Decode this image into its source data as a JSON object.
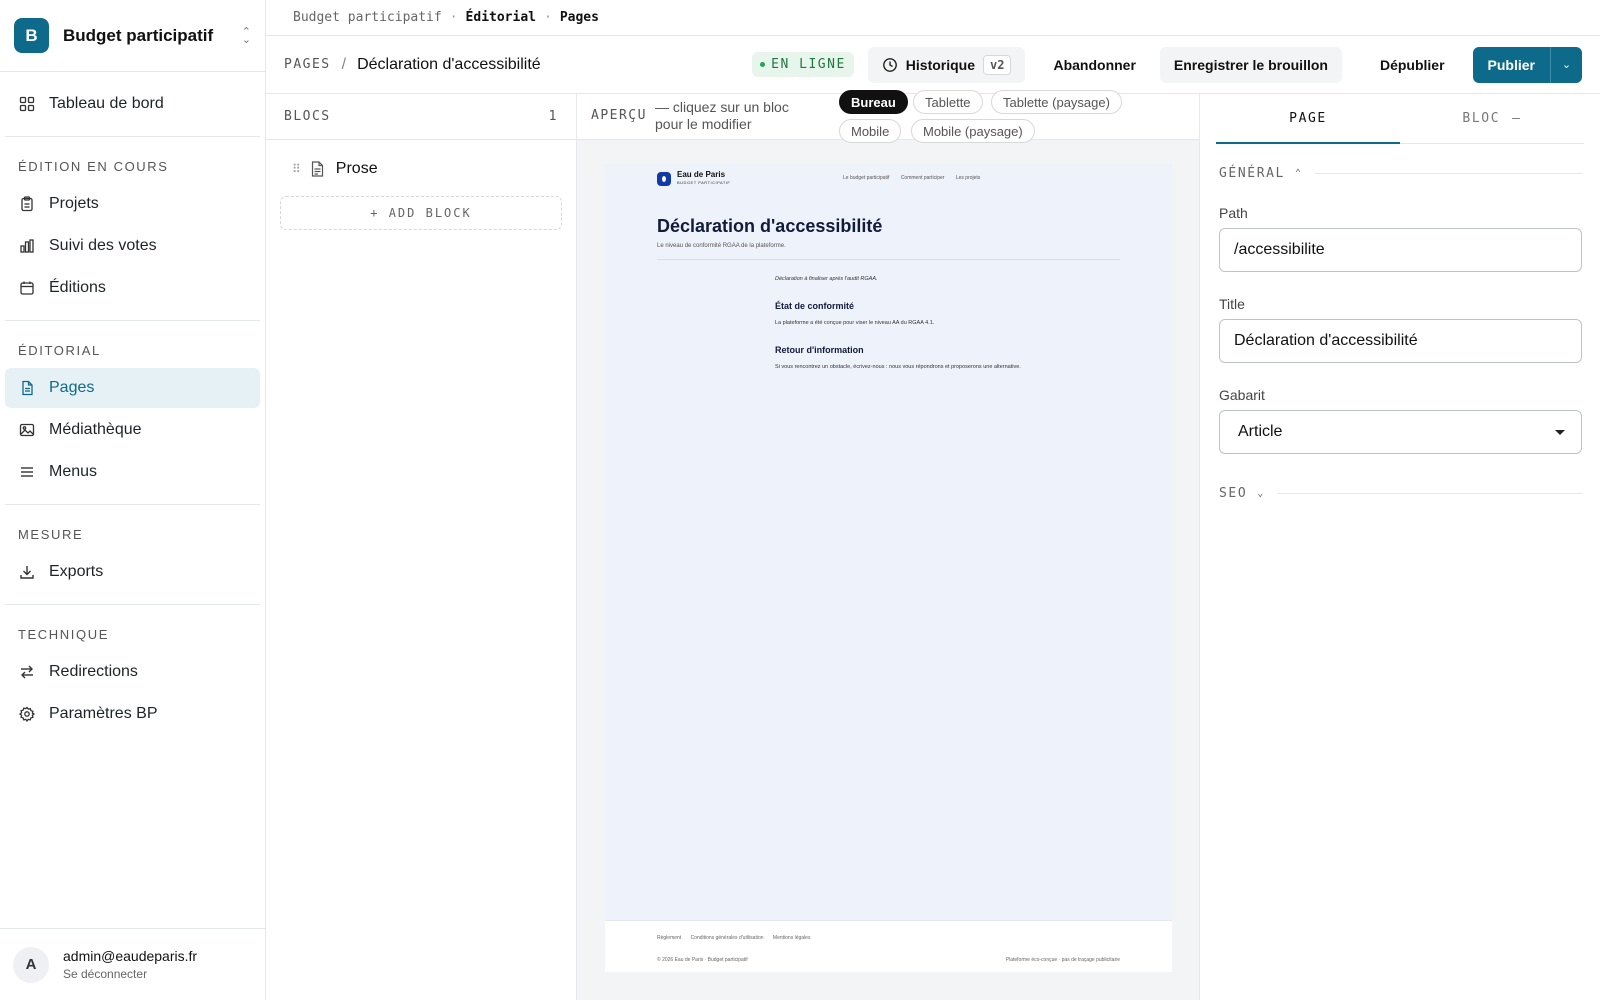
{
  "sidebar": {
    "workspace": {
      "initial": "B",
      "name": "Budget participatif"
    },
    "dashboard": {
      "label": "Tableau de bord",
      "icon": "grid-icon"
    },
    "groups": [
      {
        "title": "ÉDITION EN COURS",
        "items": [
          {
            "label": "Projets",
            "icon": "clipboard-icon"
          },
          {
            "label": "Suivi des votes",
            "icon": "bar-chart-icon"
          },
          {
            "label": "Éditions",
            "icon": "calendar-icon"
          }
        ]
      },
      {
        "title": "ÉDITORIAL",
        "items": [
          {
            "label": "Pages",
            "icon": "file-icon",
            "active": true
          },
          {
            "label": "Médiathèque",
            "icon": "image-icon"
          },
          {
            "label": "Menus",
            "icon": "menu-icon"
          }
        ]
      },
      {
        "title": "MESURE",
        "items": [
          {
            "label": "Exports",
            "icon": "download-icon"
          }
        ]
      },
      {
        "title": "TECHNIQUE",
        "items": [
          {
            "label": "Redirections",
            "icon": "arrows-icon"
          },
          {
            "label": "Paramètres BP",
            "icon": "gear-icon"
          }
        ]
      }
    ],
    "user": {
      "initial": "A",
      "email": "admin@eaudeparis.fr",
      "logout": "Se déconnecter"
    }
  },
  "breadcrumb": {
    "root": "Budget participatif",
    "sep": "·",
    "section": "Éditorial",
    "page": "Pages"
  },
  "header": {
    "section": "PAGES",
    "slash": "/",
    "title": "Déclaration d'accessibilité",
    "status": "EN LIGNE",
    "history_label": "Historique",
    "history_version": "v2",
    "discard": "Abandonner",
    "save_draft": "Enregistrer le brouillon",
    "unpublish": "Dépublier",
    "publish": "Publier"
  },
  "blocks": {
    "title": "BLOCS",
    "count": "1",
    "items": [
      {
        "label": "Prose"
      }
    ],
    "add": "+ ADD BLOCK"
  },
  "preview": {
    "title": "APERÇU",
    "hint": "— cliquez sur un bloc pour le modifier",
    "devices": [
      "Bureau",
      "Tablette",
      "Tablette (paysage)",
      "Mobile",
      "Mobile (paysage)"
    ],
    "active_device": "Bureau",
    "site": {
      "brand": "Eau de Paris",
      "brand_sub": "BUDGET PARTICIPATIF",
      "nav": [
        "Le budget participatif",
        "Comment participer",
        "Les projets"
      ],
      "h1": "Déclaration d'accessibilité",
      "lead": "Le niveau de conformité RGAA de la plateforme.",
      "note": "Déclaration à finaliser après l'audit RGAA.",
      "sections": [
        {
          "h2": "État de conformité",
          "p": "La plateforme a été conçue pour viser le niveau AA du RGAA 4.1."
        },
        {
          "h2": "Retour d'information",
          "p": "Si vous rencontrez un obstacle, écrivez-nous : nous vous répondrons et proposerons une alternative."
        }
      ],
      "footer_links": [
        "Règlement",
        "Conditions générales d'utilisation",
        "Mentions légales"
      ],
      "footer_copy": "© 2026 Eau de Paris · Budget participatif",
      "footer_eco": "Plateforme éco-conçue · pas de traçage publicitaire"
    }
  },
  "inspector": {
    "tabs": {
      "page": "PAGE",
      "block": "BLOC",
      "block_suffix": "—"
    },
    "general": "GÉNÉRAL",
    "fields": {
      "path_label": "Path",
      "path_value": "/accessibilite",
      "title_label": "Title",
      "title_value": "Déclaration d'accessibilité",
      "template_label": "Gabarit",
      "template_value": "Article"
    },
    "seo": "SEO"
  },
  "colors": {
    "accent": "#0e6a8a",
    "status_green": "#1e7a3c",
    "preview_bg": "#eef2fa"
  }
}
